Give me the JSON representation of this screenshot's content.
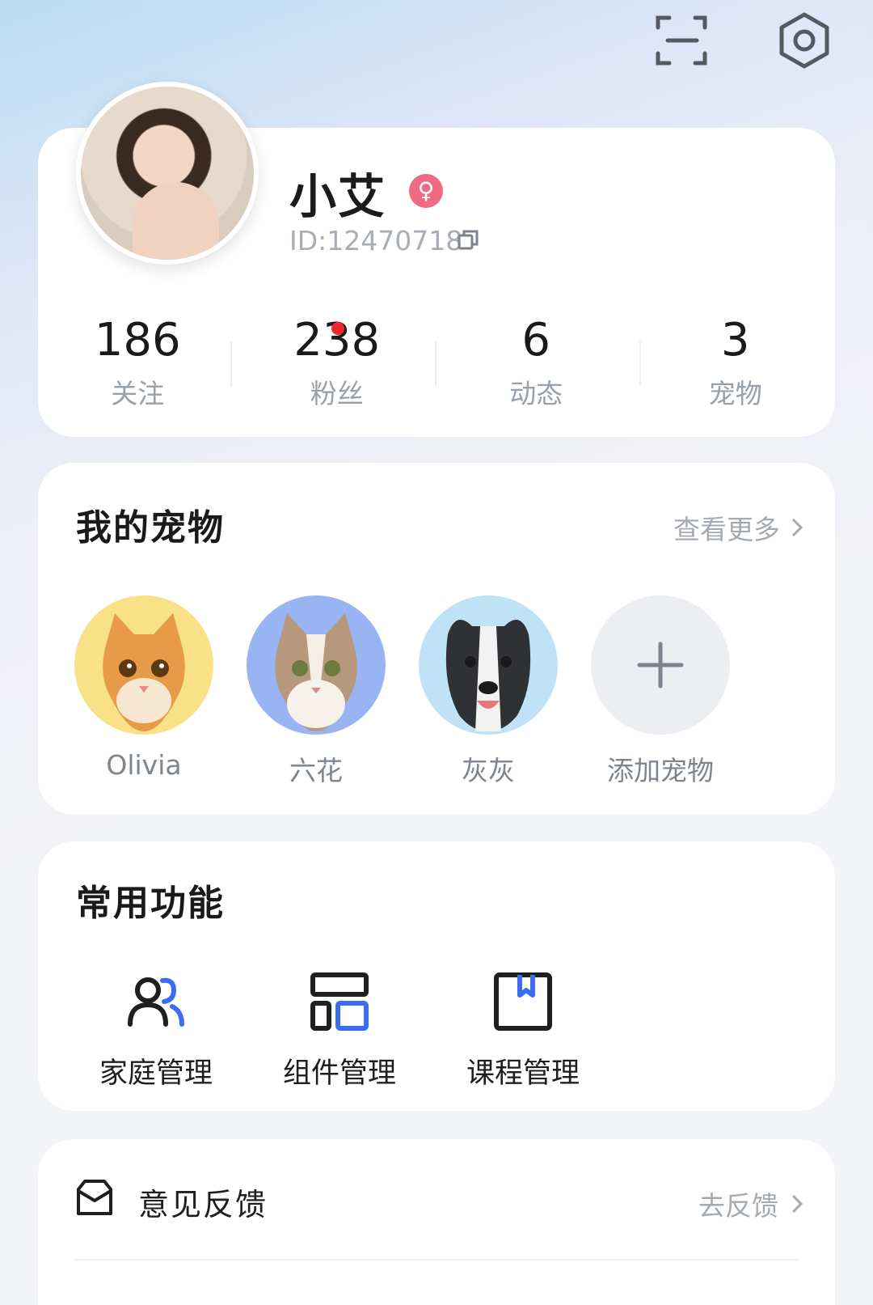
{
  "header": {
    "scan_icon": "scan-icon",
    "settings_icon": "settings-icon"
  },
  "profile": {
    "name": "小艾",
    "gender_symbol": "♀",
    "id_text": "ID:12470718",
    "stats": [
      {
        "value": "186",
        "label": "关注"
      },
      {
        "value": "238",
        "label": "粉丝",
        "has_dot": true
      },
      {
        "value": "6",
        "label": "动态"
      },
      {
        "value": "3",
        "label": "宠物"
      }
    ]
  },
  "pets": {
    "title": "我的宠物",
    "more_label": "查看更多",
    "items": [
      {
        "name": "Olivia",
        "bg": "#f8e187"
      },
      {
        "name": "六花",
        "bg": "#98b4f2"
      },
      {
        "name": "灰灰",
        "bg": "#bfe2f6"
      }
    ],
    "add_label": "添加宠物"
  },
  "functions": {
    "title": "常用功能",
    "items": [
      {
        "label": "家庭管理"
      },
      {
        "label": "组件管理"
      },
      {
        "label": "课程管理"
      }
    ]
  },
  "list": {
    "items": [
      {
        "label": "意见反馈",
        "action": "去反馈"
      }
    ]
  },
  "colors": {
    "accent": "#3a6df0",
    "gender_pink": "#f06a85",
    "badge_red": "#f0262b"
  }
}
